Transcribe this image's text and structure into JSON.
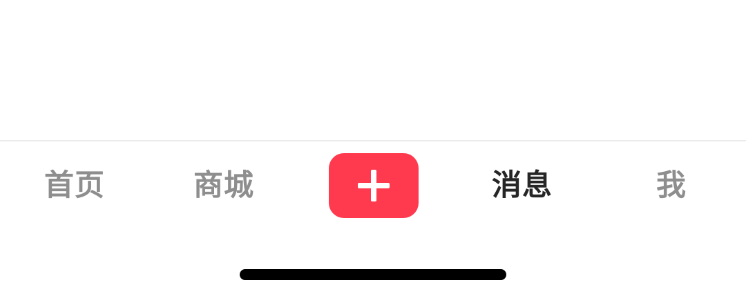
{
  "tab_bar": {
    "tabs": [
      {
        "label": "首页",
        "active": false
      },
      {
        "label": "商城",
        "active": false
      },
      {
        "label": "消息",
        "active": true
      },
      {
        "label": "我",
        "active": false
      }
    ],
    "publish_button": {
      "icon": "plus-icon",
      "color": "#ff3a4e"
    }
  },
  "colors": {
    "active_text": "#262626",
    "inactive_text": "#8e8e8e",
    "divider": "#ebebeb",
    "home_indicator": "#000000"
  }
}
